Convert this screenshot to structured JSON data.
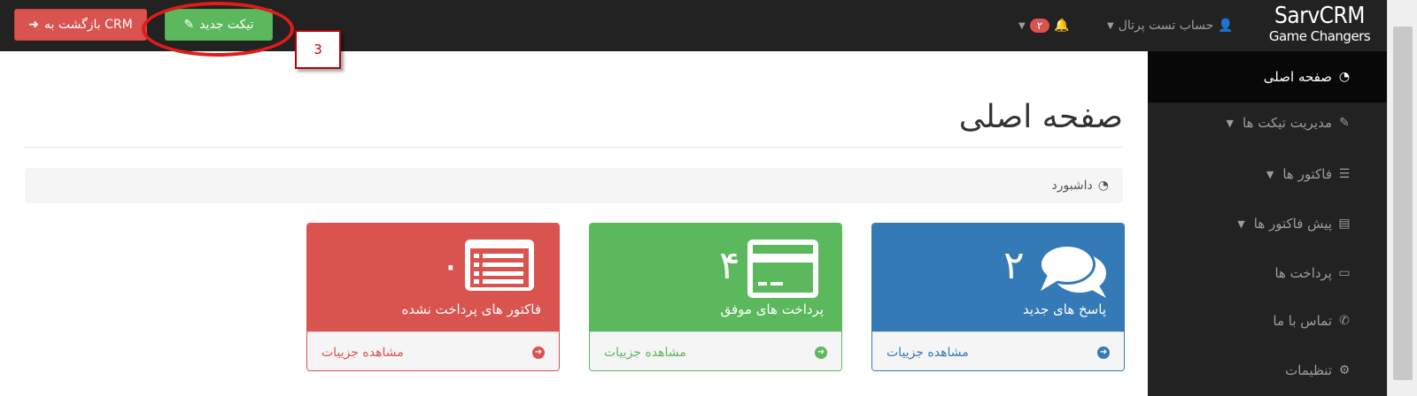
{
  "topbar": {
    "back_button": "بازگشت به CRM",
    "new_ticket_button": "تیکت جدید",
    "notification_count": "۲",
    "account_label": "حساب تست پرتال",
    "logo_main": "SarvCRM",
    "logo_sub": "Game Changers"
  },
  "annotation": {
    "callout_number": "3"
  },
  "sidebar": {
    "items": [
      {
        "label": "صفحه اصلی",
        "icon": "dashboard-icon",
        "active": true
      },
      {
        "label": "مدیریت تیکت ها",
        "icon": "ticket-icon",
        "dropdown": true
      },
      {
        "label": "فاکتور ها",
        "icon": "list-alt-icon",
        "dropdown": true
      },
      {
        "label": "پیش فاکتور ها",
        "icon": "file-icon",
        "dropdown": true
      },
      {
        "label": "پرداخت ها",
        "icon": "credit-card-icon"
      },
      {
        "label": "تماس با ما",
        "icon": "phone-icon"
      },
      {
        "label": "تنظیمات",
        "icon": "cogs-icon"
      }
    ]
  },
  "main": {
    "page_title": "صفحه اصلی",
    "breadcrumb": "داشبورد",
    "cards": [
      {
        "count": "۲",
        "label": "پاسخ های جدید",
        "link": "مشاهده جزییات",
        "color": "#337ab7",
        "icon": "comments-icon"
      },
      {
        "count": "۴",
        "label": "پرداخت های موفق",
        "link": "مشاهده جزییات",
        "color": "#5cb85c",
        "icon": "credit-card-icon"
      },
      {
        "count": "۰",
        "label": "فاکتور های پرداخت نشده",
        "link": "مشاهده جزییات",
        "color": "#d9534f",
        "icon": "list-alt-icon"
      }
    ]
  }
}
